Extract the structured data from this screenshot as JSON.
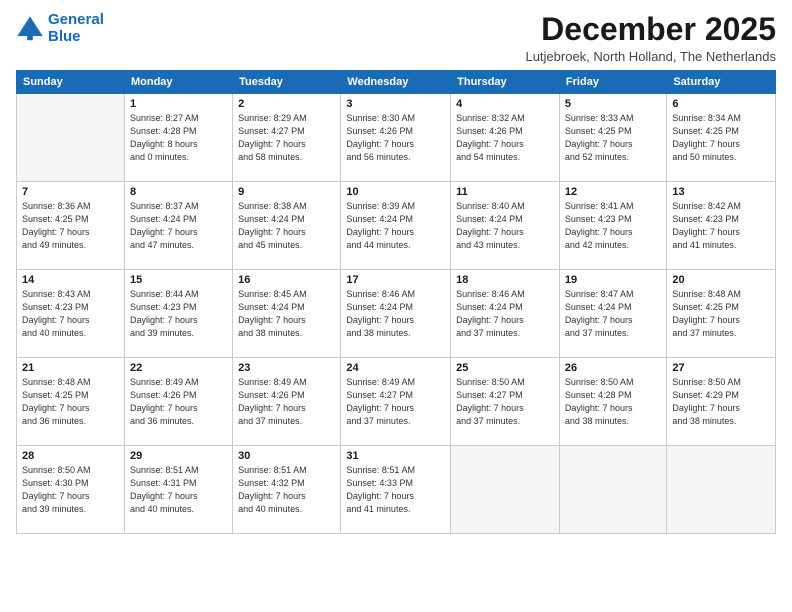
{
  "logo": {
    "line1": "General",
    "line2": "Blue"
  },
  "title": "December 2025",
  "subtitle": "Lutjebroek, North Holland, The Netherlands",
  "days_of_week": [
    "Sunday",
    "Monday",
    "Tuesday",
    "Wednesday",
    "Thursday",
    "Friday",
    "Saturday"
  ],
  "weeks": [
    [
      {
        "day": "",
        "info": ""
      },
      {
        "day": "1",
        "info": "Sunrise: 8:27 AM\nSunset: 4:28 PM\nDaylight: 8 hours\nand 0 minutes."
      },
      {
        "day": "2",
        "info": "Sunrise: 8:29 AM\nSunset: 4:27 PM\nDaylight: 7 hours\nand 58 minutes."
      },
      {
        "day": "3",
        "info": "Sunrise: 8:30 AM\nSunset: 4:26 PM\nDaylight: 7 hours\nand 56 minutes."
      },
      {
        "day": "4",
        "info": "Sunrise: 8:32 AM\nSunset: 4:26 PM\nDaylight: 7 hours\nand 54 minutes."
      },
      {
        "day": "5",
        "info": "Sunrise: 8:33 AM\nSunset: 4:25 PM\nDaylight: 7 hours\nand 52 minutes."
      },
      {
        "day": "6",
        "info": "Sunrise: 8:34 AM\nSunset: 4:25 PM\nDaylight: 7 hours\nand 50 minutes."
      }
    ],
    [
      {
        "day": "7",
        "info": "Sunrise: 8:36 AM\nSunset: 4:25 PM\nDaylight: 7 hours\nand 49 minutes."
      },
      {
        "day": "8",
        "info": "Sunrise: 8:37 AM\nSunset: 4:24 PM\nDaylight: 7 hours\nand 47 minutes."
      },
      {
        "day": "9",
        "info": "Sunrise: 8:38 AM\nSunset: 4:24 PM\nDaylight: 7 hours\nand 45 minutes."
      },
      {
        "day": "10",
        "info": "Sunrise: 8:39 AM\nSunset: 4:24 PM\nDaylight: 7 hours\nand 44 minutes."
      },
      {
        "day": "11",
        "info": "Sunrise: 8:40 AM\nSunset: 4:24 PM\nDaylight: 7 hours\nand 43 minutes."
      },
      {
        "day": "12",
        "info": "Sunrise: 8:41 AM\nSunset: 4:23 PM\nDaylight: 7 hours\nand 42 minutes."
      },
      {
        "day": "13",
        "info": "Sunrise: 8:42 AM\nSunset: 4:23 PM\nDaylight: 7 hours\nand 41 minutes."
      }
    ],
    [
      {
        "day": "14",
        "info": "Sunrise: 8:43 AM\nSunset: 4:23 PM\nDaylight: 7 hours\nand 40 minutes."
      },
      {
        "day": "15",
        "info": "Sunrise: 8:44 AM\nSunset: 4:23 PM\nDaylight: 7 hours\nand 39 minutes."
      },
      {
        "day": "16",
        "info": "Sunrise: 8:45 AM\nSunset: 4:24 PM\nDaylight: 7 hours\nand 38 minutes."
      },
      {
        "day": "17",
        "info": "Sunrise: 8:46 AM\nSunset: 4:24 PM\nDaylight: 7 hours\nand 38 minutes."
      },
      {
        "day": "18",
        "info": "Sunrise: 8:46 AM\nSunset: 4:24 PM\nDaylight: 7 hours\nand 37 minutes."
      },
      {
        "day": "19",
        "info": "Sunrise: 8:47 AM\nSunset: 4:24 PM\nDaylight: 7 hours\nand 37 minutes."
      },
      {
        "day": "20",
        "info": "Sunrise: 8:48 AM\nSunset: 4:25 PM\nDaylight: 7 hours\nand 37 minutes."
      }
    ],
    [
      {
        "day": "21",
        "info": "Sunrise: 8:48 AM\nSunset: 4:25 PM\nDaylight: 7 hours\nand 36 minutes."
      },
      {
        "day": "22",
        "info": "Sunrise: 8:49 AM\nSunset: 4:26 PM\nDaylight: 7 hours\nand 36 minutes."
      },
      {
        "day": "23",
        "info": "Sunrise: 8:49 AM\nSunset: 4:26 PM\nDaylight: 7 hours\nand 37 minutes."
      },
      {
        "day": "24",
        "info": "Sunrise: 8:49 AM\nSunset: 4:27 PM\nDaylight: 7 hours\nand 37 minutes."
      },
      {
        "day": "25",
        "info": "Sunrise: 8:50 AM\nSunset: 4:27 PM\nDaylight: 7 hours\nand 37 minutes."
      },
      {
        "day": "26",
        "info": "Sunrise: 8:50 AM\nSunset: 4:28 PM\nDaylight: 7 hours\nand 38 minutes."
      },
      {
        "day": "27",
        "info": "Sunrise: 8:50 AM\nSunset: 4:29 PM\nDaylight: 7 hours\nand 38 minutes."
      }
    ],
    [
      {
        "day": "28",
        "info": "Sunrise: 8:50 AM\nSunset: 4:30 PM\nDaylight: 7 hours\nand 39 minutes."
      },
      {
        "day": "29",
        "info": "Sunrise: 8:51 AM\nSunset: 4:31 PM\nDaylight: 7 hours\nand 40 minutes."
      },
      {
        "day": "30",
        "info": "Sunrise: 8:51 AM\nSunset: 4:32 PM\nDaylight: 7 hours\nand 40 minutes."
      },
      {
        "day": "31",
        "info": "Sunrise: 8:51 AM\nSunset: 4:33 PM\nDaylight: 7 hours\nand 41 minutes."
      },
      {
        "day": "",
        "info": ""
      },
      {
        "day": "",
        "info": ""
      },
      {
        "day": "",
        "info": ""
      }
    ]
  ]
}
